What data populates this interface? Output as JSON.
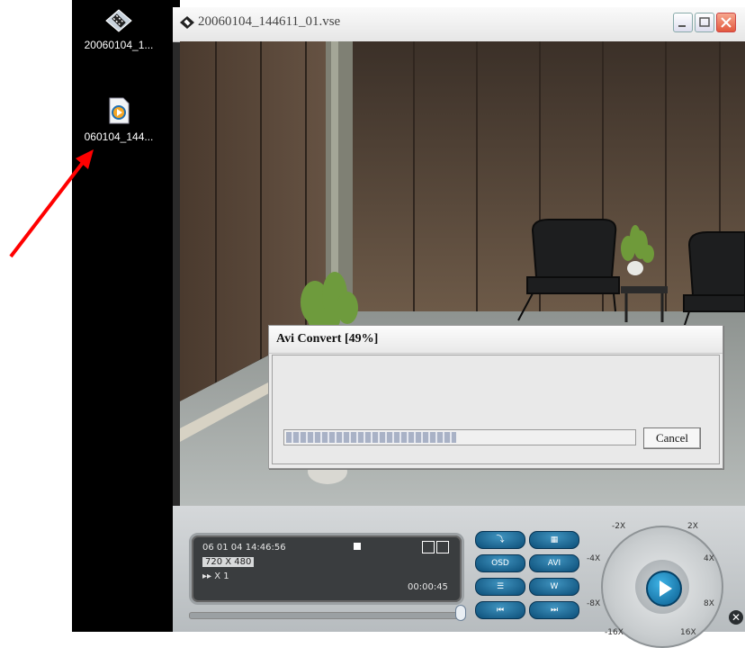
{
  "desktop": {
    "icons": [
      {
        "label": "20060104_1...",
        "icon": "film-file-icon"
      },
      {
        "label": "060104_144...",
        "icon": "media-player-file-icon"
      }
    ],
    "arrow_color": "#ff0000"
  },
  "window": {
    "title": "20060104_144611_01.vse",
    "controls": [
      "minimize",
      "maximize",
      "close"
    ]
  },
  "dialog": {
    "title": "Avi Convert [49%]",
    "progress": 0.49,
    "cancel_label": "Cancel"
  },
  "player": {
    "date_time": "06 01 04   14:46:56",
    "resolution": "720 X 480",
    "speed": "▸▸ X 1",
    "elapsed": "00:00:45",
    "buttons": [
      "OSD",
      "AVI",
      "W"
    ],
    "speeds": {
      "neg2x": "-2X",
      "pos2x": "2X",
      "neg4x": "-4X",
      "pos4x": "4X",
      "neg8x": "-8X",
      "pos8x": "8X",
      "neg16x": "-16X",
      "pos16x": "16X"
    }
  }
}
